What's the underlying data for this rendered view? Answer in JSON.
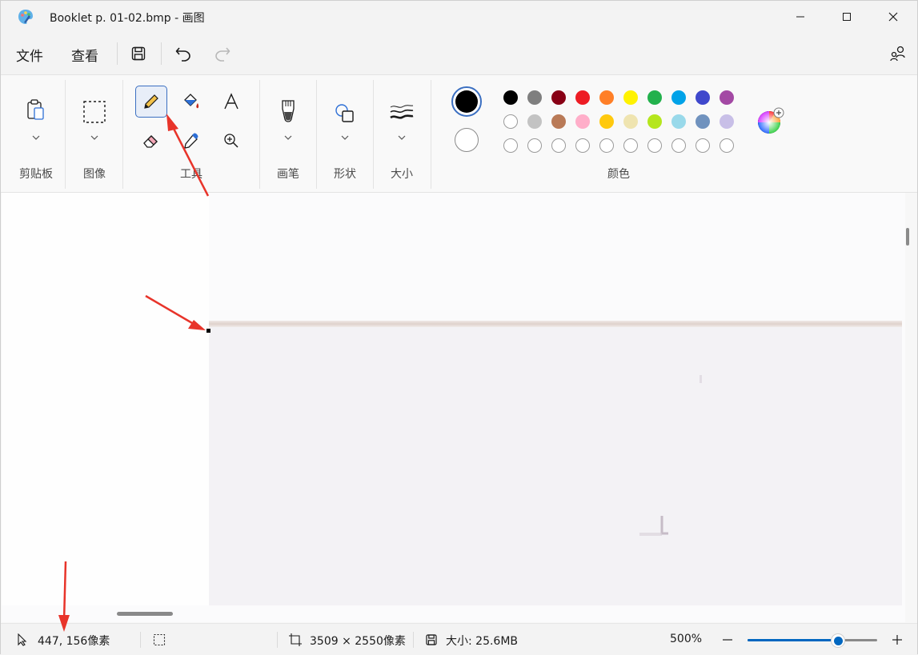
{
  "window": {
    "title": "Booklet p. 01-02.bmp - 画图"
  },
  "menu": {
    "file": "文件",
    "view": "查看"
  },
  "ribbon": {
    "groups": {
      "clipboard": "剪贴板",
      "image": "图像",
      "tools": "工具",
      "brushes": "画笔",
      "shapes": "形状",
      "size": "大小",
      "colors": "颜色"
    }
  },
  "colors": {
    "primary": "#000000",
    "secondary": "#ffffff",
    "accent": "#0067c0",
    "palette_row1": [
      "#000000",
      "#7f7f7f",
      "#880015",
      "#ed1c24",
      "#ff7f27",
      "#fff200",
      "#22b14c",
      "#00a2e8",
      "#3f48cc",
      "#a349a4"
    ],
    "palette_row2": [
      "#ffffff",
      "#c3c3c3",
      "#b97a57",
      "#ffaec9",
      "#ffc90e",
      "#efe4b0",
      "#b5e61d",
      "#99d9ea",
      "#7092be",
      "#c8bfe7"
    ],
    "palette_row3": [
      "#ffffff",
      "#ffffff",
      "#ffffff",
      "#ffffff",
      "#ffffff",
      "#ffffff",
      "#ffffff",
      "#ffffff",
      "#ffffff",
      "#ffffff"
    ]
  },
  "status": {
    "cursor_pos": "447, 156像素",
    "canvas_size": "3509 × 2550像素",
    "file_size": "大小: 25.6MB",
    "zoom": "500%",
    "zoom_slider_fraction": 0.7
  }
}
